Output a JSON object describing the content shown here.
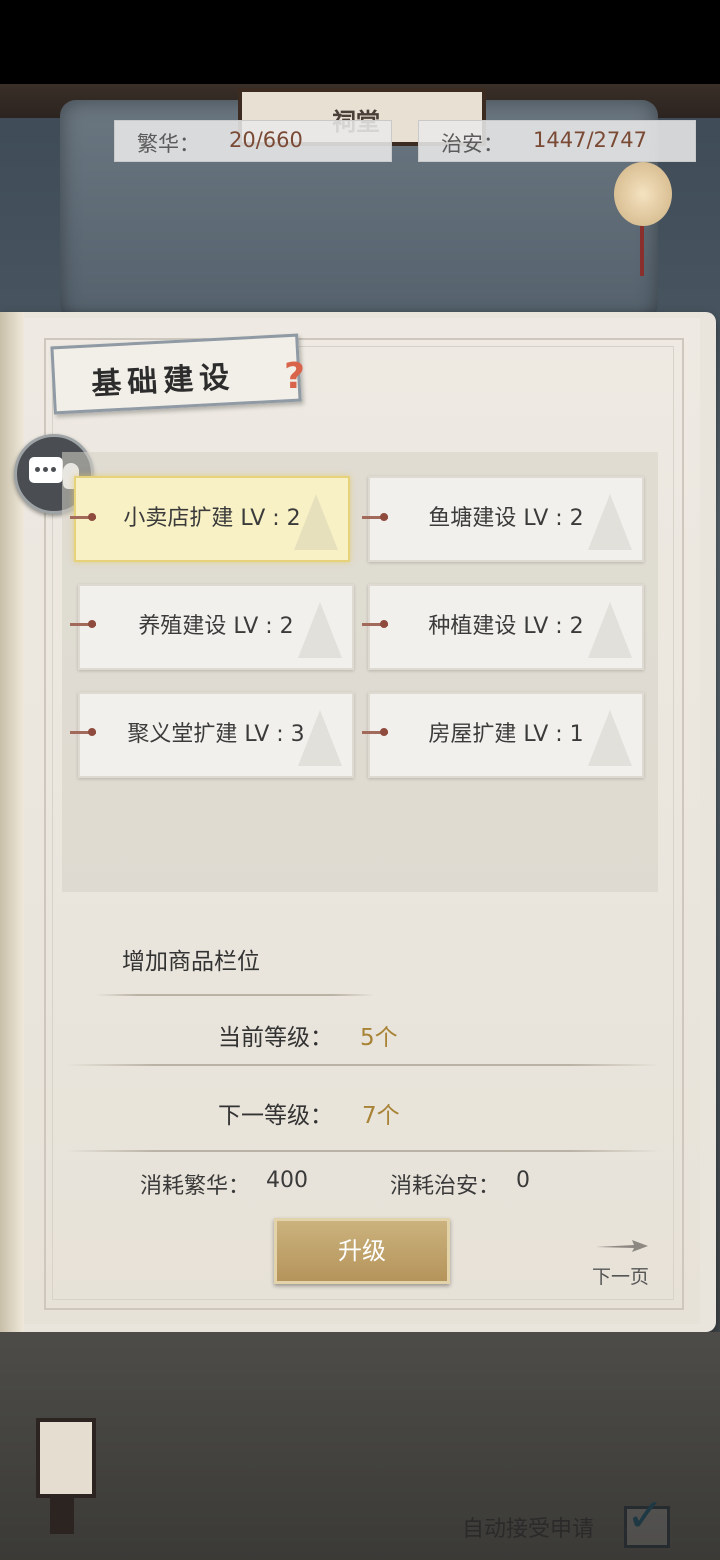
{
  "header": {
    "building_sign": "祠堂",
    "prosperity": {
      "label": "繁华：",
      "value": "20/660"
    },
    "security": {
      "label": "治安：",
      "value": "1447/2747"
    }
  },
  "panel": {
    "title": "基础建设",
    "help_icon": "?"
  },
  "buildings": [
    {
      "label": "小卖店扩建 LV : 2",
      "selected": true
    },
    {
      "label": "鱼塘建设 LV : 2",
      "selected": false
    },
    {
      "label": "养殖建设 LV : 2",
      "selected": false
    },
    {
      "label": "种植建设 LV : 2",
      "selected": false
    },
    {
      "label": "聚义堂扩建 LV : 3",
      "selected": false
    },
    {
      "label": "房屋扩建 LV : 1",
      "selected": false
    }
  ],
  "detail": {
    "description": "增加商品栏位",
    "current_level_label": "当前等级：",
    "current_level_value": "5个",
    "next_level_label": "下一等级：",
    "next_level_value": "7个",
    "cost_prosperity_label": "消耗繁华：",
    "cost_prosperity_value": "400",
    "cost_security_label": "消耗治安：",
    "cost_security_value": "0"
  },
  "actions": {
    "upgrade": "升级",
    "next_page": "下一页"
  },
  "footer": {
    "auto_accept_label": "自动接受申请",
    "auto_accept_checked": true
  },
  "colors": {
    "accent_gold": "#a88336",
    "selected_card": "#f8f1c5",
    "button": "#bf9f65"
  }
}
